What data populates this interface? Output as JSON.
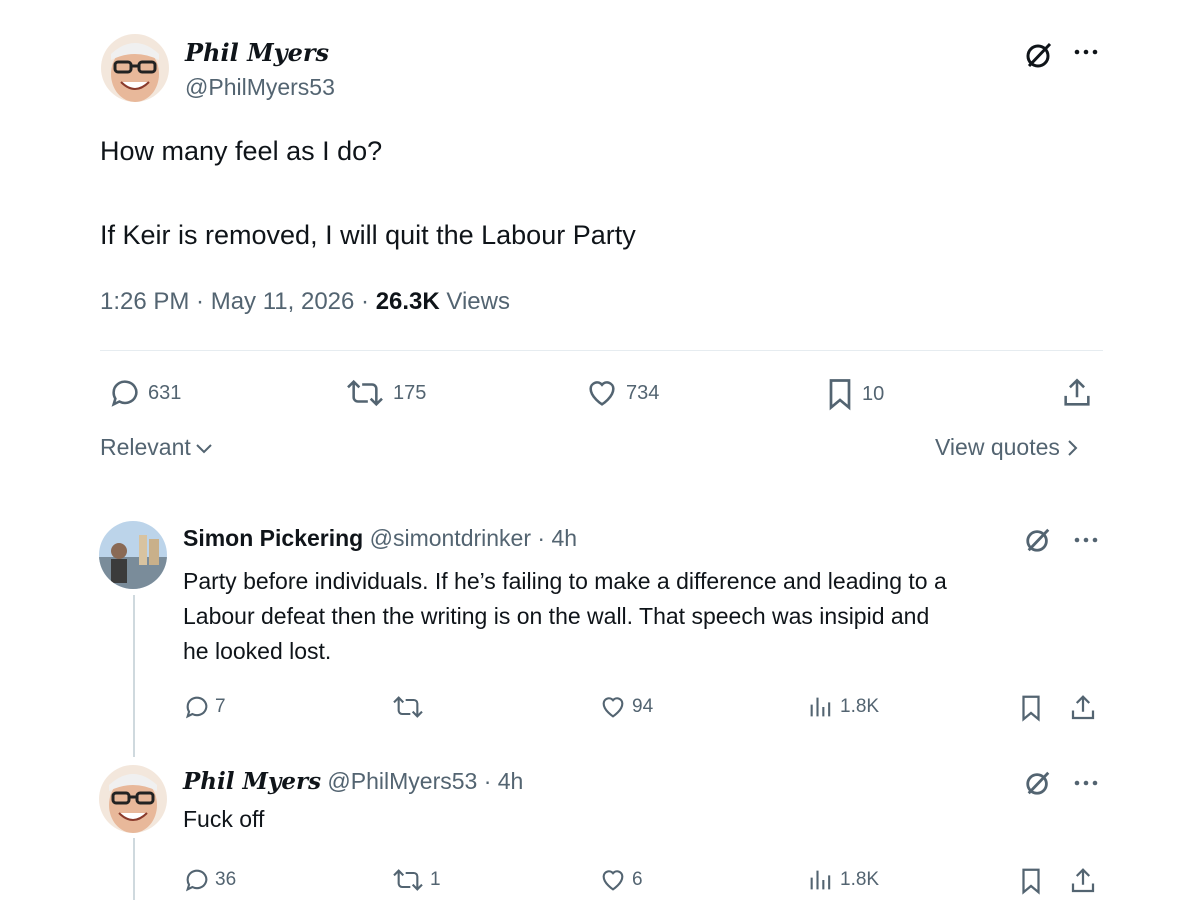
{
  "main_tweet": {
    "author_name": "Phil Myers",
    "author_handle": "@PhilMyers53",
    "text_line1": "How many feel as I do?",
    "text_line2": "If Keir is removed, I will quit the Labour Party",
    "time": "1:26 PM · May 11, 2026 · ",
    "views_count": "26.3K",
    "views_label": " Views",
    "stats": {
      "replies": "631",
      "reposts": "175",
      "likes": "734",
      "bookmarks": "10"
    }
  },
  "controls": {
    "sort_label": "Relevant",
    "view_quotes_label": "View quotes"
  },
  "replies": [
    {
      "author_name": "Simon Pickering",
      "author_handle": "@simontdrinker",
      "time": "· 4h",
      "text_line1": "Party before individuals. If he’s failing to make a difference and leading to a",
      "text_line2": "Labour defeat then the writing is on the wall. That speech was insipid and",
      "text_line3": "he looked lost.",
      "stats": {
        "replies": "7",
        "reposts": "",
        "likes": "94",
        "views": "1.8K"
      }
    },
    {
      "author_name": "Phil Myers",
      "author_handle": "@PhilMyers53",
      "time": "· 4h",
      "text_line1": "Fuck off",
      "stats": {
        "replies": "36",
        "reposts": "1",
        "likes": "6",
        "views": "1.8K"
      }
    }
  ],
  "colors": {
    "text": "#0f1419",
    "muted": "#536471",
    "divider": "#e6ecf0"
  }
}
